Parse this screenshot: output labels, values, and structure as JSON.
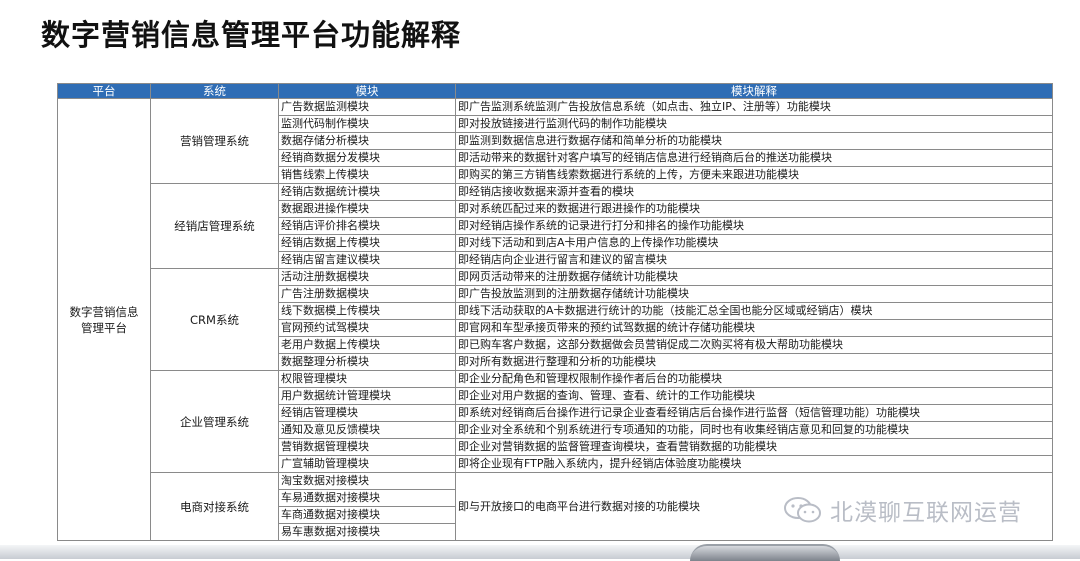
{
  "title": "数字营销信息管理平台功能解释",
  "table": {
    "headers": [
      "平台",
      "系统",
      "模块",
      "模块解释"
    ],
    "platform": "数字营销信息管理平台",
    "groups": [
      {
        "system": "营销管理系统",
        "rows": [
          {
            "module": "广告数据监测模块",
            "desc": "即广告监测系统监测广告投放信息系统（如点击、独立IP、注册等）功能模块"
          },
          {
            "module": "监测代码制作模块",
            "desc": "即对投放链接进行监测代码的制作功能模块"
          },
          {
            "module": "数据存储分析模块",
            "desc": "即监测到数据信息进行数据存储和简单分析的功能模块"
          },
          {
            "module": "经销商数据分发模块",
            "desc": "即活动带来的数据针对客户填写的经销店信息进行经销商后台的推送功能模块"
          },
          {
            "module": "销售线索上传模块",
            "desc": "即购买的第三方销售线索数据进行系统的上传，方便未来跟进功能模块"
          }
        ]
      },
      {
        "system": "经销店管理系统",
        "rows": [
          {
            "module": "经销店数据统计模块",
            "desc": "即经销店接收数据来源并查看的模块"
          },
          {
            "module": "数据跟进操作模块",
            "desc": "即对系统匹配过来的数据进行跟进操作的功能模块"
          },
          {
            "module": "经销店评价排名模块",
            "desc": "即对经销店操作系统的记录进行打分和排名的操作功能模块"
          },
          {
            "module": "经销店数据上传模块",
            "desc": "即对线下活动和到店A卡用户信息的上传操作功能模块"
          },
          {
            "module": "经销店留言建议模块",
            "desc": "即经销店向企业进行留言和建议的留言模块"
          }
        ]
      },
      {
        "system": "CRM系统",
        "rows": [
          {
            "module": "活动注册数据模块",
            "desc": "即网页活动带来的注册数据存储统计功能模块"
          },
          {
            "module": "广告注册数据模块",
            "desc": "即广告投放监测到的注册数据存储统计功能模块"
          },
          {
            "module": "线下数据模上传模块",
            "desc": "即线下活动获取的A卡数据进行统计的功能（技能汇总全国也能分区域或经销店）模块"
          },
          {
            "module": "官网预约试驾模块",
            "desc": "即官网和车型承接页带来的预约试驾数据的统计存储功能模块"
          },
          {
            "module": "老用户数据上传模块",
            "desc": "即已购车客户数据，这部分数据做会员营销促成二次购买将有极大帮助功能模块"
          },
          {
            "module": "数据整理分析模块",
            "desc": "即对所有数据进行整理和分析的功能模块"
          }
        ]
      },
      {
        "system": "企业管理系统",
        "rows": [
          {
            "module": "权限管理模块",
            "desc": "即企业分配角色和管理权限制作操作者后台的功能模块"
          },
          {
            "module": "用户数据统计管理模块",
            "desc": "即企业对用户数据的查询、管理、查看、统计的工作功能模块"
          },
          {
            "module": "经销店管理模块",
            "desc": "即系统对经销商后台操作进行记录企业查看经销店后台操作进行监督（短信管理功能）功能模块"
          },
          {
            "module": "通知及意见反馈模块",
            "desc": "即企业对全系统和个别系统进行专项通知的功能，同时也有收集经销店意见和回复的功能模块"
          },
          {
            "module": "营销数据管理模块",
            "desc": "即企业对营销数据的监督管理查询模块，查看营销数据的功能模块"
          },
          {
            "module": "广宣辅助管理模块",
            "desc": "即将企业现有FTP融入系统内，提升经销店体验度功能模块"
          }
        ]
      },
      {
        "system": "电商对接系统",
        "desc": "即与开放接口的电商平台进行数据对接的功能模块",
        "rows": [
          {
            "module": "淘宝数据对接模块"
          },
          {
            "module": "车易通数据对接模块"
          },
          {
            "module": "车商通数据对接模块"
          },
          {
            "module": "易车惠数据对接模块"
          }
        ]
      }
    ]
  },
  "watermark": "北漠聊互联网运营",
  "colors": {
    "header_bg": "#2f6db5",
    "header_text": "#ffffff",
    "border": "#8a8a8a",
    "watermark": "#b9bdc6"
  }
}
